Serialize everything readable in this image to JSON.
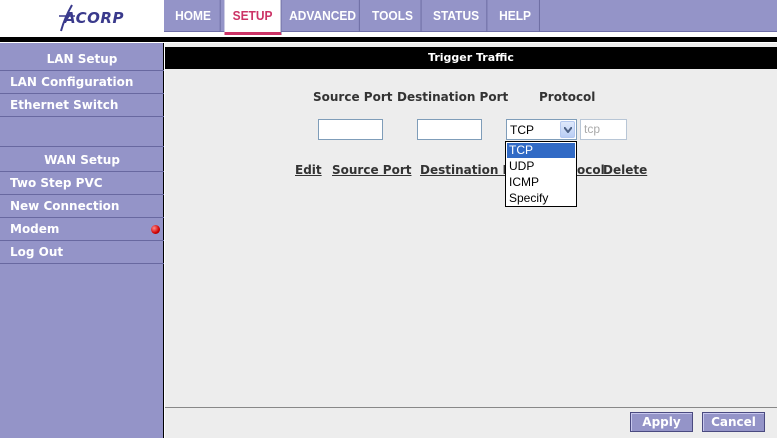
{
  "logo": {
    "text": "ACORP"
  },
  "nav": {
    "items": [
      "HOME",
      "SETUP",
      "ADVANCED",
      "TOOLS",
      "STATUS",
      "HELP"
    ],
    "active": "SETUP",
    "accent_color": "#cc3366"
  },
  "sidebar": {
    "lan_header": "LAN Setup",
    "lan_configuration": "LAN Configuration",
    "ethernet_switch": "Ethernet Switch",
    "wan_header": "WAN Setup",
    "two_step_pvc": "Two Step PVC",
    "new_connection": "New Connection",
    "modem": "Modem",
    "log_out": "Log Out"
  },
  "content": {
    "title": "Trigger Traffic",
    "labels": {
      "source_port": "Source Port",
      "destination_port": "Destination Port",
      "protocol": "Protocol"
    },
    "protocol_select": {
      "value": "TCP",
      "options": [
        "TCP",
        "UDP",
        "ICMP",
        "Specify"
      ],
      "highlighted": "TCP"
    },
    "protocol_text": {
      "value": "tcp"
    },
    "table_headers": {
      "edit": "Edit",
      "source_port": "Source Port",
      "destination_port": "Destination P",
      "protocol_tail": "ocol",
      "delete": "Delete"
    }
  },
  "buttons": {
    "apply": "Apply",
    "cancel": "Cancel"
  }
}
